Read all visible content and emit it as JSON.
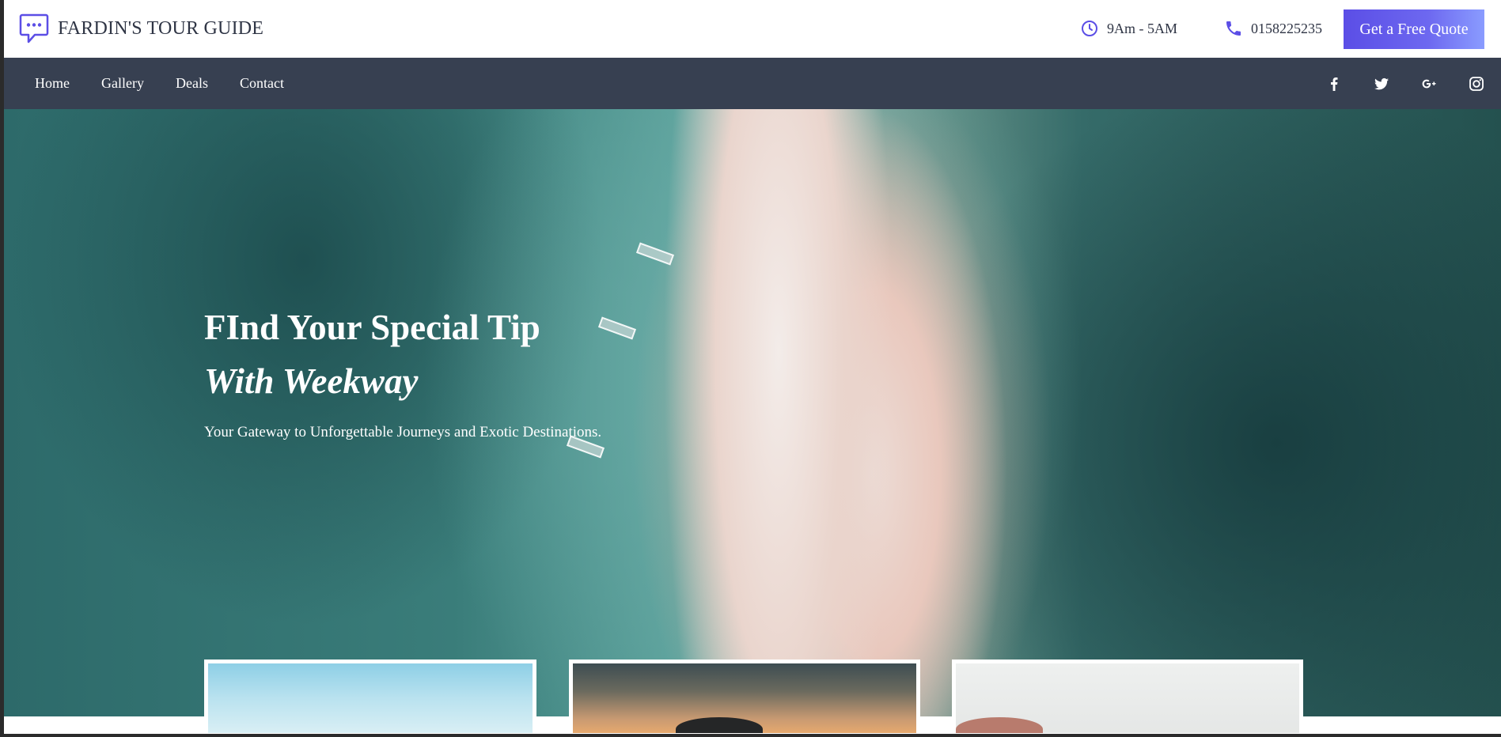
{
  "brand": {
    "name": "FARDIN'S TOUR GUIDE",
    "icon": "chat-bubble-icon"
  },
  "contact": {
    "hours": "9Am - 5AM",
    "hours_icon": "clock-icon",
    "phone": "0158225235",
    "phone_icon": "phone-icon"
  },
  "cta": {
    "label": "Get a Free Quote"
  },
  "nav": {
    "items": [
      {
        "label": "Home"
      },
      {
        "label": "Gallery"
      },
      {
        "label": "Deals"
      },
      {
        "label": "Contact"
      }
    ]
  },
  "social": [
    "facebook-icon",
    "twitter-icon",
    "google-plus-icon",
    "instagram-icon"
  ],
  "hero": {
    "title": "FInd Your Special Tip",
    "subtitle": "With Weekway",
    "tagline": "Your Gateway to Unforgettable Journeys and Exotic Destinations."
  },
  "colors": {
    "nav_bg": "#374051",
    "accent": "#5b4ee6",
    "brand_text": "#2f3545"
  }
}
